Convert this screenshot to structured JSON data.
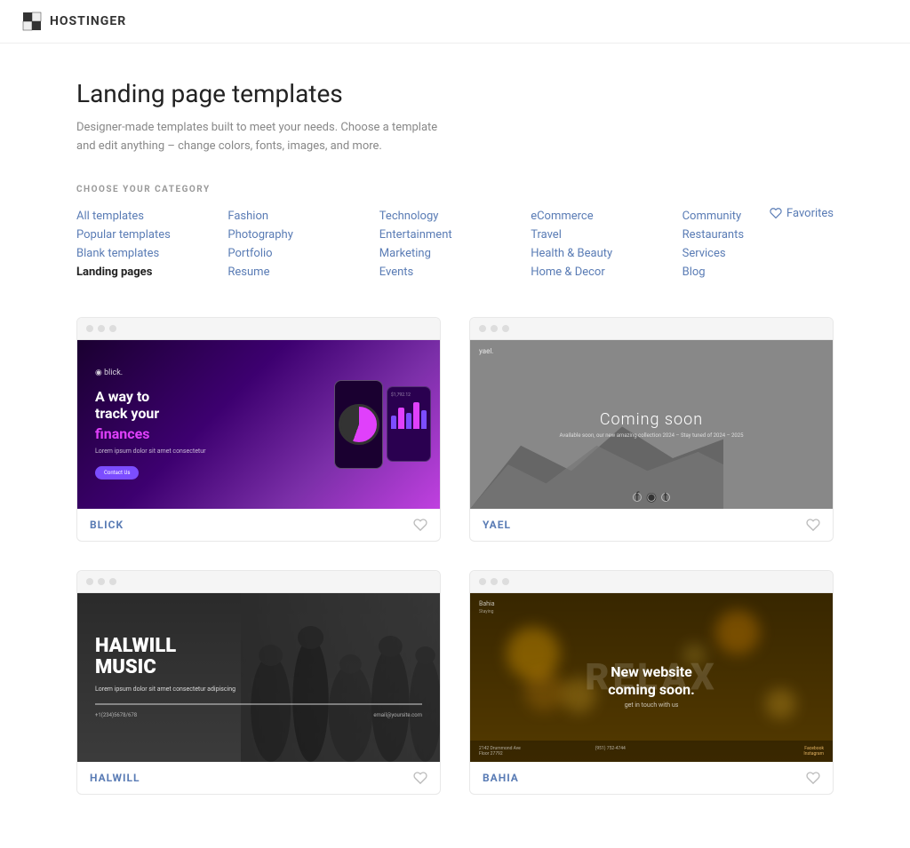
{
  "header": {
    "logo_text": "HOSTINGER"
  },
  "page": {
    "title": "Landing page templates",
    "subtitle": "Designer-made templates built to meet your needs. Choose a template and edit anything – change colors, fonts, images, and more.",
    "category_label": "CHOOSE YOUR CATEGORY"
  },
  "categories": {
    "col1": [
      {
        "id": "all",
        "label": "All templates",
        "active": false
      },
      {
        "id": "popular",
        "label": "Popular templates",
        "active": false
      },
      {
        "id": "blank",
        "label": "Blank templates",
        "active": false
      },
      {
        "id": "landing",
        "label": "Landing pages",
        "active": true
      }
    ],
    "col2": [
      {
        "id": "fashion",
        "label": "Fashion",
        "active": false
      },
      {
        "id": "photography",
        "label": "Photography",
        "active": false
      },
      {
        "id": "portfolio",
        "label": "Portfolio",
        "active": false
      },
      {
        "id": "resume",
        "label": "Resume",
        "active": false
      }
    ],
    "col3": [
      {
        "id": "technology",
        "label": "Technology",
        "active": false
      },
      {
        "id": "entertainment",
        "label": "Entertainment",
        "active": false
      },
      {
        "id": "marketing",
        "label": "Marketing",
        "active": false
      },
      {
        "id": "events",
        "label": "Events",
        "active": false
      }
    ],
    "col4": [
      {
        "id": "ecommerce",
        "label": "eCommerce",
        "active": false
      },
      {
        "id": "travel",
        "label": "Travel",
        "active": false
      },
      {
        "id": "health",
        "label": "Health & Beauty",
        "active": false
      },
      {
        "id": "home",
        "label": "Home & Decor",
        "active": false
      }
    ],
    "col5": [
      {
        "id": "community",
        "label": "Community",
        "active": false
      },
      {
        "id": "restaurants",
        "label": "Restaurants",
        "active": false
      },
      {
        "id": "services",
        "label": "Services",
        "active": false
      },
      {
        "id": "blog",
        "label": "Blog",
        "active": false
      }
    ],
    "favorites": "Favorites"
  },
  "templates": [
    {
      "id": "blick",
      "name": "BLICK",
      "type": "blick"
    },
    {
      "id": "yael",
      "name": "YAEL",
      "type": "yael"
    },
    {
      "id": "halwill",
      "name": "HALWILL",
      "type": "halwill"
    },
    {
      "id": "bahia",
      "name": "BAHIA",
      "type": "bahia"
    }
  ],
  "colors": {
    "link": "#5a7cb5",
    "active": "#222222",
    "accent": "#7c4dff"
  }
}
